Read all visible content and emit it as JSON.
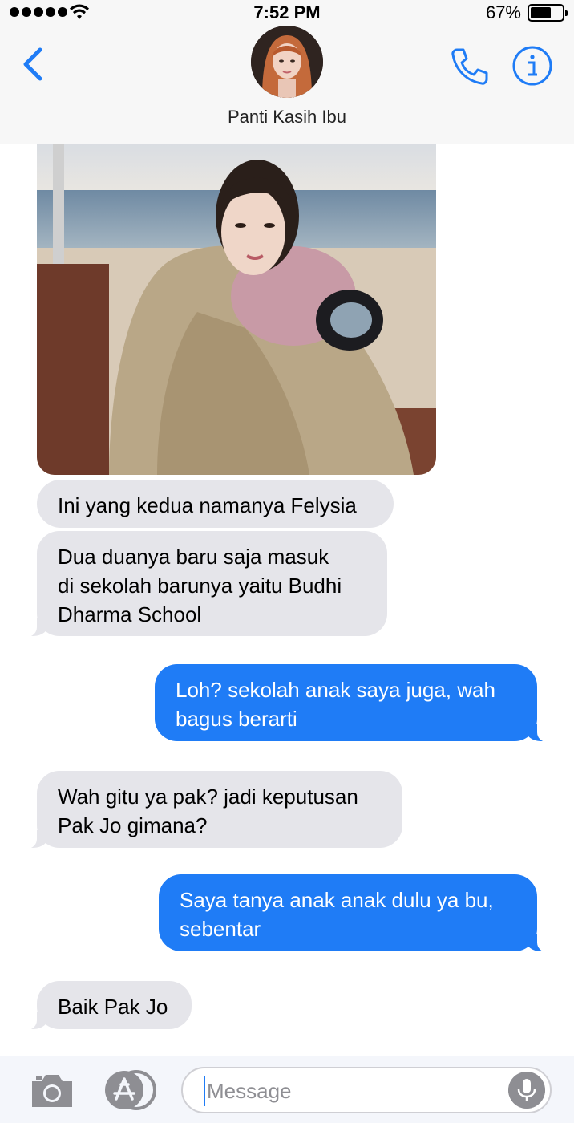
{
  "status_bar": {
    "time": "7:52 PM",
    "battery_percent": "67%",
    "battery_level": 0.67,
    "signal_dots": 5,
    "wifi_icon": "wifi-icon"
  },
  "header": {
    "back_icon": "chevron-left-icon",
    "contact_name": "Panti Kasih Ibu",
    "call_icon": "phone-icon",
    "info_icon": "info-icon"
  },
  "messages": [
    {
      "direction": "in",
      "type": "photo",
      "description_icon": "photo-attachment"
    },
    {
      "direction": "in",
      "text": "Ini yang kedua namanya Felysia"
    },
    {
      "direction": "in",
      "lines": [
        "Dua duanya baru saja masuk",
        "di sekolah barunya yaitu Budhi",
        "Dharma School"
      ]
    },
    {
      "direction": "out",
      "lines": [
        "Loh? sekolah anak saya juga, wah",
        "bagus berarti"
      ]
    },
    {
      "direction": "in",
      "lines": [
        "Wah gitu ya pak? jadi keputusan",
        "Pak Jo gimana?"
      ]
    },
    {
      "direction": "out",
      "lines": [
        "Saya tanya anak anak dulu ya bu,",
        "sebentar"
      ]
    },
    {
      "direction": "in",
      "text": "Baik Pak Jo"
    }
  ],
  "input_bar": {
    "camera_icon": "camera-icon",
    "apps_icon": "app-store-icon",
    "placeholder": "Message",
    "mic_icon": "microphone-icon"
  },
  "colors": {
    "accent": "#1f7cf6",
    "incoming_bubble": "#e5e5ea",
    "header_bg": "#f7f7f7"
  }
}
